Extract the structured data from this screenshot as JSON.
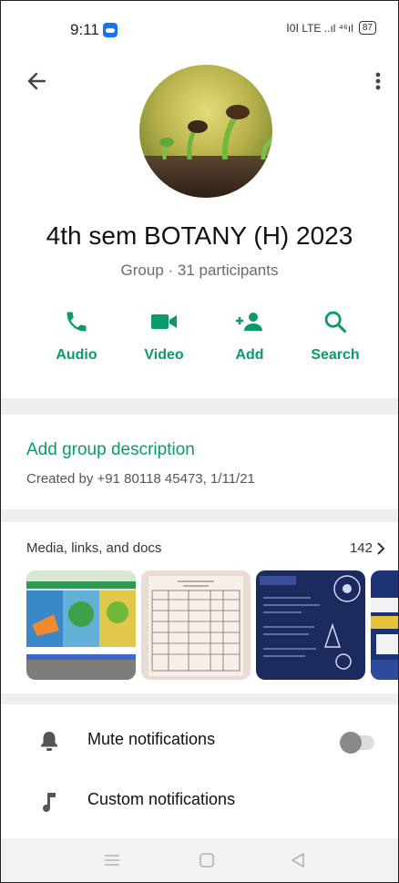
{
  "status_bar": {
    "time": "9:11",
    "right_indicators": "Ⅰ0Ⅰ LTE ..ıl ⁴⁶ıl",
    "battery": "87"
  },
  "header": {
    "back_icon": "arrow-left-icon",
    "more_icon": "more-vertical-icon"
  },
  "group": {
    "name": "4th sem BOTANY (H) 2023",
    "subtitle": "Group · 31 participants"
  },
  "actions": [
    {
      "label": "Audio",
      "icon": "phone-icon"
    },
    {
      "label": "Video",
      "icon": "video-icon"
    },
    {
      "label": "Add",
      "icon": "add-person-icon"
    },
    {
      "label": "Search",
      "icon": "search-icon"
    }
  ],
  "description": {
    "link": "Add group description",
    "created": "Created by +91 80118 45473, 1/11/21"
  },
  "media": {
    "title": "Media, links, and docs",
    "count": "142"
  },
  "settings": [
    {
      "label": "Mute notifications",
      "icon": "bell-icon",
      "toggle": false
    },
    {
      "label": "Custom notifications",
      "icon": "music-note-icon"
    }
  ],
  "colors": {
    "accent": "#0b9a6c",
    "divider": "#efefef"
  }
}
